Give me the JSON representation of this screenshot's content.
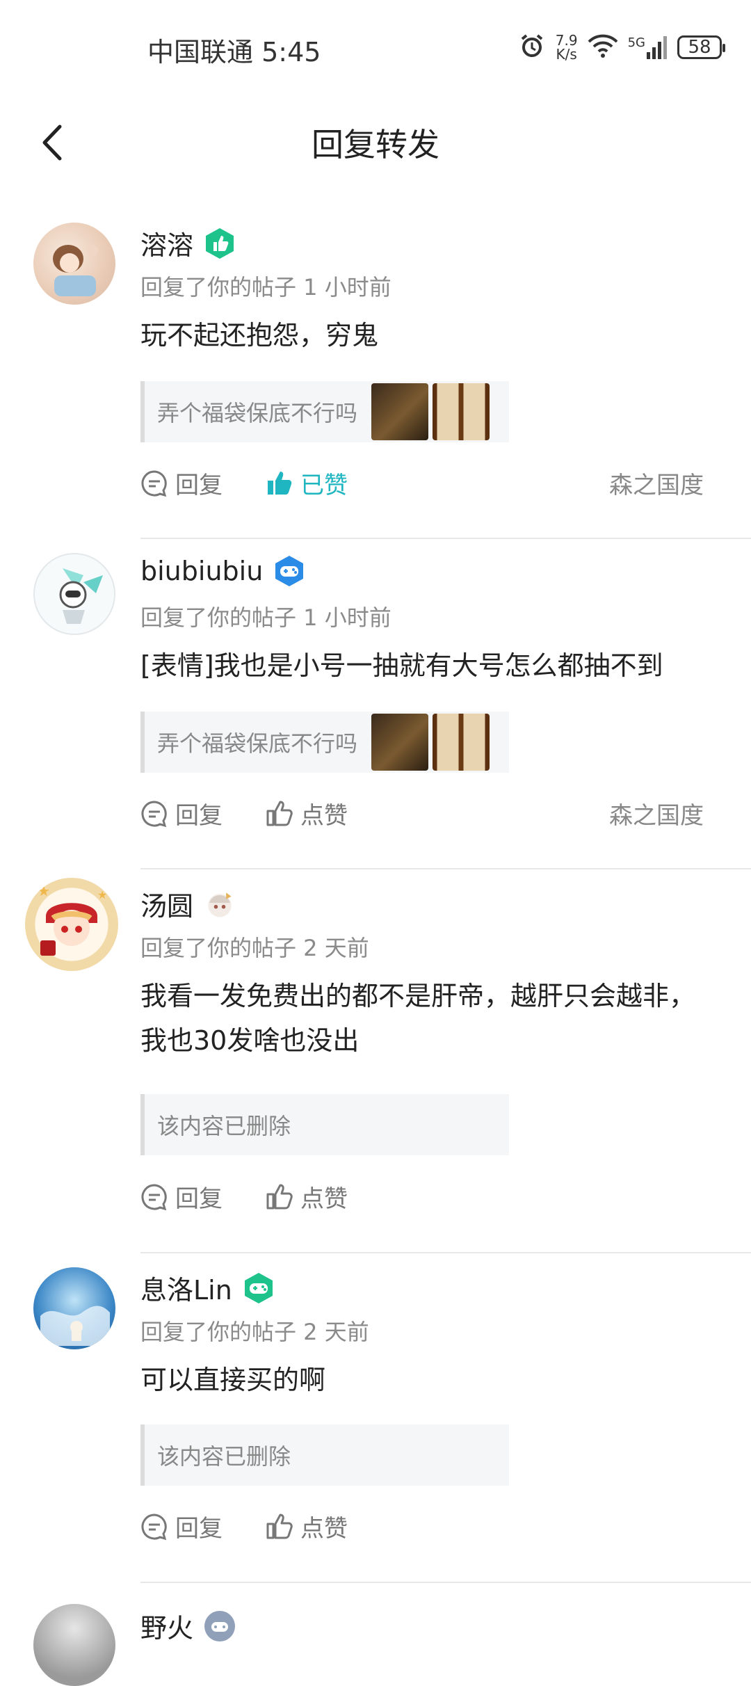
{
  "status_bar": {
    "carrier": "中国联通",
    "time": "5:45",
    "net_speed_value": "7.9",
    "net_speed_unit": "K/s",
    "network": "5G",
    "battery": "58"
  },
  "header": {
    "title": "回复转发"
  },
  "colors": {
    "accent": "#1fb6c2",
    "badge_green": "#1ec28b",
    "badge_blue": "#2b8ce8",
    "badge_gray": "#8fa0b8"
  },
  "items": [
    {
      "username": "溶溶",
      "badge_icon": "thumb-badge-icon",
      "meta": "回复了你的帖子 1 小时前",
      "content": "玩不起还抱怨，穷鬼",
      "quote": "弄个福袋保底不行吗",
      "quote_has_images": true,
      "reply_label": "回复",
      "like_label": "已赞",
      "liked": true,
      "forum": "森之国度"
    },
    {
      "username": "biubiubiu",
      "badge_icon": "gamepad-badge-icon",
      "meta": "回复了你的帖子 1 小时前",
      "content": "[表情]我也是小号一抽就有大号怎么都抽不到",
      "quote": "弄个福袋保底不行吗",
      "quote_has_images": true,
      "reply_label": "回复",
      "like_label": "点赞",
      "liked": false,
      "forum": "森之国度"
    },
    {
      "username": "汤圆",
      "badge_icon": "character-badge-icon",
      "meta": "回复了你的帖子 2 天前",
      "content": "我看一发免费出的都不是肝帝，越肝只会越非，我也30发啥也没出",
      "quote": "该内容已删除",
      "quote_has_images": false,
      "reply_label": "回复",
      "like_label": "点赞",
      "liked": false,
      "forum": ""
    },
    {
      "username": "息洛Lin",
      "badge_icon": "gamepad-badge-icon",
      "meta": "回复了你的帖子 2 天前",
      "content": "可以直接买的啊",
      "quote": "该内容已删除",
      "quote_has_images": false,
      "reply_label": "回复",
      "like_label": "点赞",
      "liked": false,
      "forum": ""
    },
    {
      "username": "野火",
      "badge_icon": "controller-badge-icon"
    }
  ]
}
